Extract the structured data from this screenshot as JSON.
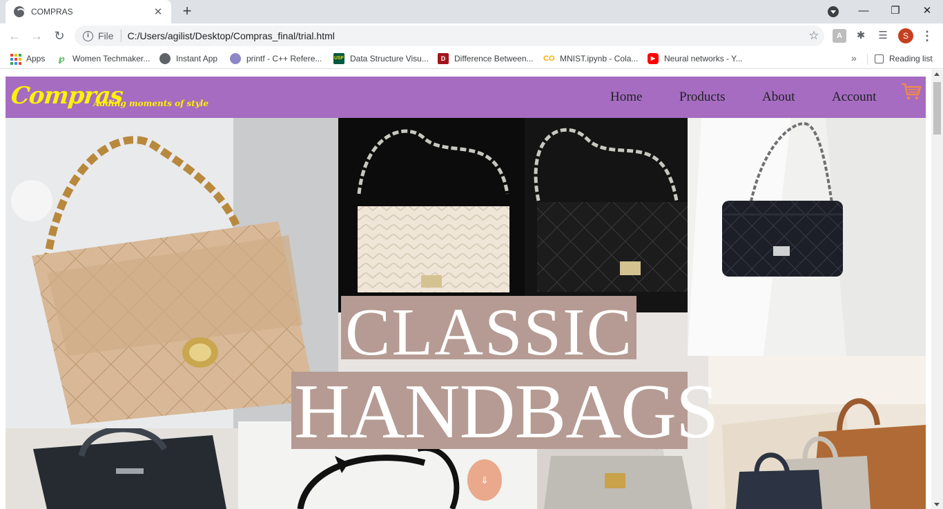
{
  "browser": {
    "tab_title": "COMPRAS",
    "tab_close": "✕",
    "new_tab": "+",
    "omnibox_file_label": "File",
    "omnibox_url": "C:/Users/agilist/Desktop/Compras_final/trial.html",
    "avatar_initial": "S",
    "reading_list": "Reading list",
    "bookmarks_more": "»",
    "bookmarks": [
      {
        "label": "Apps",
        "icon": "apps-grid-icon"
      },
      {
        "label": "Women Techmaker...",
        "icon": "techmakers-icon"
      },
      {
        "label": "Instant App",
        "icon": "globe-icon"
      },
      {
        "label": "printf - C++ Refere...",
        "icon": "cplusplus-icon"
      },
      {
        "label": "Data Structure Visu...",
        "icon": "usf-icon"
      },
      {
        "label": "Difference Between...",
        "icon": "td-icon"
      },
      {
        "label": "MNIST.ipynb - Cola...",
        "icon": "colab-icon"
      },
      {
        "label": "Neural networks - Y...",
        "icon": "youtube-icon"
      }
    ]
  },
  "site": {
    "logo": "Compras",
    "tagline": "Adding moments of style",
    "nav": [
      "Home",
      "Products",
      "About",
      "Account"
    ],
    "cart_icon": "shopping-cart-icon",
    "brand_color": "#a56cc1",
    "logo_color": "#fff200",
    "hero": {
      "line1": "CLASSIC",
      "line2": "HANDBAGS",
      "scroll_button": "⇓",
      "scroll_button_color": "#eaa98c",
      "title_box_color": "#b59b93"
    }
  }
}
